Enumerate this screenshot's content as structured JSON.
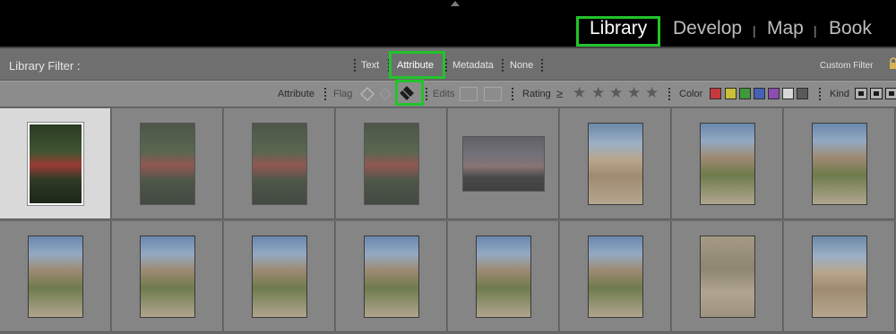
{
  "modules": {
    "library": "Library",
    "develop": "Develop",
    "map": "Map",
    "book": "Book",
    "separator": "|"
  },
  "filter_bar": {
    "title": "Library Filter :",
    "tabs": [
      "Text",
      "Attribute",
      "Metadata",
      "None"
    ],
    "active_tab": "Attribute",
    "preset": "Custom Filter"
  },
  "attribute_bar": {
    "attribute_label": "Attribute",
    "flag_label": "Flag",
    "edits_label": "Edits",
    "rating_label": "Rating",
    "rating_operator": "≥",
    "stars": [
      "★",
      "★",
      "★",
      "★",
      "★"
    ],
    "color_label": "Color",
    "kind_label": "Kind",
    "colors": [
      "#c7383b",
      "#c9c03a",
      "#3f9a3a",
      "#4660b8",
      "#8c4fb0",
      "#d8d8d8",
      "#5a5a5a"
    ],
    "active_flag": "reject-flag-icon"
  },
  "grid": {
    "selected_index": 0,
    "dimmed_indices": [
      1,
      2,
      3,
      4
    ],
    "thumbnails": [
      "forest-portrait",
      "forest-portrait",
      "forest-portrait",
      "forest-portrait",
      "dusk-landscape",
      "desert-rocks",
      "desert-yucca",
      "desert-yucca",
      "desert-yucca",
      "desert-yucca",
      "desert-yucca",
      "desert-yucca",
      "desert-yucca",
      "desert-yucca",
      "cactus-closeup",
      "desert-rocks"
    ]
  }
}
